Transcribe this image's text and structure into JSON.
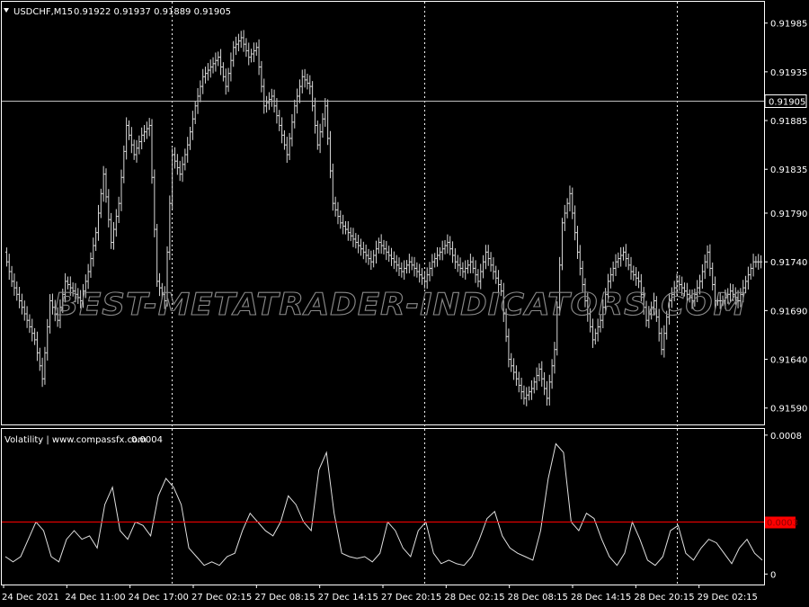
{
  "header": {
    "symbol_title": "USDCHF,M15",
    "ohlc": "0.91922 0.91937 0.91889 0.91905",
    "collapse_icon": "triangle-down-icon"
  },
  "indicator": {
    "title": "Volatility | www.compassfx.com",
    "value": "0.0004"
  },
  "watermark": "BEST-METATRADER-INDICATORS.COM",
  "colors": {
    "background": "#000000",
    "foreground": "#ffffff",
    "level_line": "#ff0000",
    "level_label_bg": "#ff0000",
    "level_label_text": "#8b0000"
  },
  "chart_data": [
    {
      "type": "bar",
      "name": "price",
      "y_ticks": [
        "0.91985",
        "0.91935",
        "0.91885",
        "0.91835",
        "0.91790",
        "0.91740",
        "0.91690",
        "0.91640",
        "0.91590"
      ],
      "ylim": [
        0.91575,
        0.92005
      ],
      "current_price": 0.91905,
      "current_price_label": "0.91905",
      "x_ticks": [
        "24 Dec 2021",
        "24 Dec 11:00",
        "24 Dec 17:00",
        "27 Dec 02:15",
        "27 Dec 08:15",
        "27 Dec 14:15",
        "27 Dec 20:15",
        "28 Dec 02:15",
        "28 Dec 08:15",
        "28 Dec 14:15",
        "28 Dec 20:15",
        "29 Dec 02:15"
      ],
      "session_separators": [
        "24 Dec 17:00",
        "27 Dec 20:15",
        "28 Dec 20:15"
      ],
      "closes": [
        0.9175,
        0.9172,
        0.917,
        0.9168,
        0.9166,
        0.9162,
        0.917,
        0.9168,
        0.9172,
        0.9171,
        0.917,
        0.9173,
        0.9177,
        0.9183,
        0.9176,
        0.918,
        0.9188,
        0.9185,
        0.9187,
        0.9188,
        0.9172,
        0.917,
        0.9185,
        0.9183,
        0.9186,
        0.919,
        0.9193,
        0.9194,
        0.9195,
        0.9192,
        0.9196,
        0.9197,
        0.9195,
        0.9196,
        0.919,
        0.9191,
        0.9188,
        0.9185,
        0.919,
        0.9193,
        0.9192,
        0.9186,
        0.919,
        0.918,
        0.9178,
        0.9177,
        0.9176,
        0.9175,
        0.9174,
        0.9176,
        0.9175,
        0.9174,
        0.9173,
        0.9174,
        0.9173,
        0.9172,
        0.9174,
        0.9175,
        0.9176,
        0.9174,
        0.9173,
        0.9174,
        0.9172,
        0.9175,
        0.9173,
        0.9171,
        0.9164,
        0.9162,
        0.916,
        0.9161,
        0.9163,
        0.916,
        0.9165,
        0.9178,
        0.9181,
        0.9175,
        0.917,
        0.9166,
        0.9168,
        0.9172,
        0.9174,
        0.9175,
        0.9173,
        0.9172,
        0.9168,
        0.917,
        0.9165,
        0.917,
        0.9172,
        0.9171,
        0.917,
        0.9172,
        0.9175,
        0.917,
        0.917,
        0.9171,
        0.917,
        0.9172,
        0.9174
      ]
    },
    {
      "type": "line",
      "name": "Volatility",
      "y_ticks": [
        "0.0008",
        "0"
      ],
      "ylim": [
        -5e-05,
        0.00082
      ],
      "level": 0.0003,
      "level_label": "0.0003",
      "values": [
        0.0001,
        7e-05,
        0.0001,
        0.0002,
        0.0003,
        0.00025,
        0.0001,
        7e-05,
        0.0002,
        0.00025,
        0.0002,
        0.00022,
        0.00015,
        0.0004,
        0.0005,
        0.00025,
        0.0002,
        0.0003,
        0.00028,
        0.00022,
        0.00045,
        0.00055,
        0.0005,
        0.0004,
        0.00015,
        0.0001,
        5e-05,
        7e-05,
        5e-05,
        0.0001,
        0.00012,
        0.00025,
        0.00035,
        0.0003,
        0.00025,
        0.00022,
        0.0003,
        0.00045,
        0.0004,
        0.0003,
        0.00025,
        0.0006,
        0.0007,
        0.00035,
        0.00012,
        0.0001,
        9e-05,
        0.0001,
        7e-05,
        0.00012,
        0.0003,
        0.00025,
        0.00015,
        0.0001,
        0.00025,
        0.0003,
        0.00012,
        6e-05,
        8e-05,
        6e-05,
        5e-05,
        0.0001,
        0.0002,
        0.00032,
        0.00036,
        0.00022,
        0.00015,
        0.00012,
        0.0001,
        8e-05,
        0.00025,
        0.00055,
        0.00075,
        0.0007,
        0.0003,
        0.00025,
        0.00035,
        0.00032,
        0.0002,
        0.0001,
        5e-05,
        0.00012,
        0.0003,
        0.0002,
        8e-05,
        5e-05,
        0.0001,
        0.00025,
        0.00028,
        0.00012,
        8e-05,
        0.00015,
        0.0002,
        0.00018,
        0.00012,
        6e-05,
        0.00015,
        0.0002,
        0.00012,
        8e-05
      ]
    }
  ]
}
